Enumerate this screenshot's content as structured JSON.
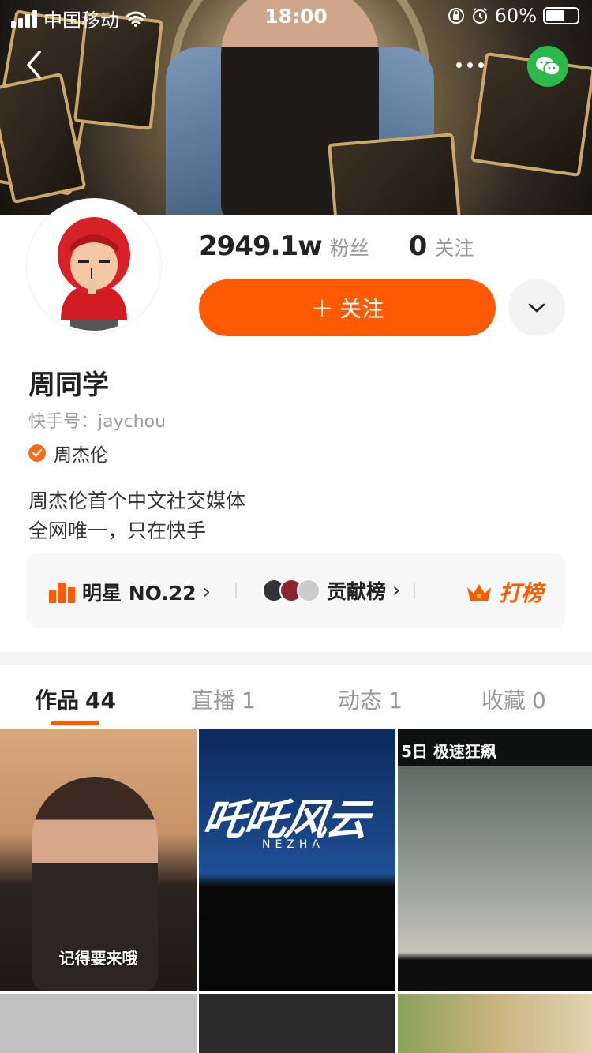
{
  "status_bar": {
    "carrier": "中国移动",
    "time": "18:00",
    "battery": "60%",
    "battery_level": 0.6
  },
  "profile": {
    "fans_count": "2949.1w",
    "fans_label": "粉丝",
    "following_count": "0",
    "following_label": "关注",
    "follow_button": "关注",
    "name": "周同学",
    "kuaishou_id": "快手号：jaychou",
    "verified_name": "周杰伦",
    "bio_line1": "周杰伦首个中文社交媒体",
    "bio_line2": "全网唯一，只在快手"
  },
  "rank_card": {
    "star_rank": "明星 NO.22",
    "contribution": "贡献榜",
    "cheer": "打榜"
  },
  "tabs": [
    {
      "label": "作品",
      "count": "44"
    },
    {
      "label": "直播",
      "count": "1"
    },
    {
      "label": "动态",
      "count": "1"
    },
    {
      "label": "收藏",
      "count": "0"
    }
  ],
  "grid": {
    "tile1_caption": "记得要来哦",
    "tile2_title": "吒吒风云",
    "tile2_sub": "NEZHA",
    "tile3_title": "5日 极速狂飙"
  },
  "colors": {
    "accent": "#fe5a03",
    "wechat": "#2cb94a"
  }
}
